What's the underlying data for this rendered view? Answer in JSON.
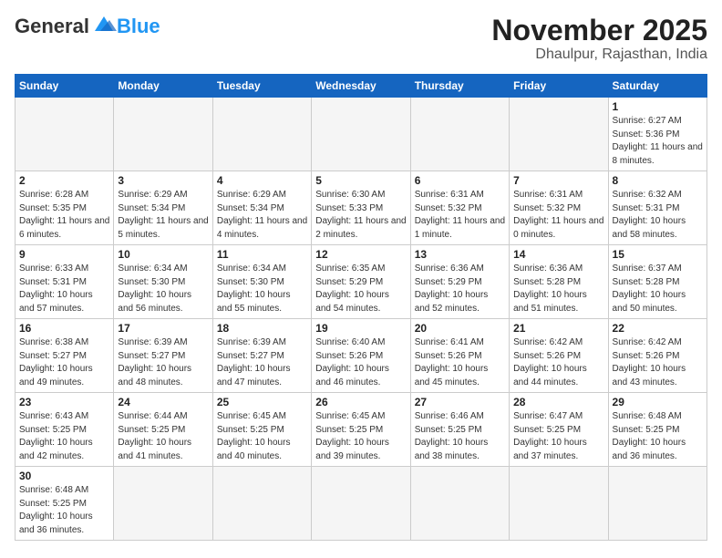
{
  "header": {
    "logo_general": "General",
    "logo_blue": "Blue",
    "month_title": "November 2025",
    "location": "Dhaulpur, Rajasthan, India"
  },
  "weekdays": [
    "Sunday",
    "Monday",
    "Tuesday",
    "Wednesday",
    "Thursday",
    "Friday",
    "Saturday"
  ],
  "weeks": [
    [
      {
        "day": "",
        "sunrise": "",
        "sunset": "",
        "daylight": "",
        "empty": true
      },
      {
        "day": "",
        "sunrise": "",
        "sunset": "",
        "daylight": "",
        "empty": true
      },
      {
        "day": "",
        "sunrise": "",
        "sunset": "",
        "daylight": "",
        "empty": true
      },
      {
        "day": "",
        "sunrise": "",
        "sunset": "",
        "daylight": "",
        "empty": true
      },
      {
        "day": "",
        "sunrise": "",
        "sunset": "",
        "daylight": "",
        "empty": true
      },
      {
        "day": "",
        "sunrise": "",
        "sunset": "",
        "daylight": "",
        "empty": true
      },
      {
        "day": "1",
        "sunrise": "Sunrise: 6:27 AM",
        "sunset": "Sunset: 5:36 PM",
        "daylight": "Daylight: 11 hours and 8 minutes.",
        "empty": false
      }
    ],
    [
      {
        "day": "2",
        "sunrise": "Sunrise: 6:28 AM",
        "sunset": "Sunset: 5:35 PM",
        "daylight": "Daylight: 11 hours and 6 minutes.",
        "empty": false
      },
      {
        "day": "3",
        "sunrise": "Sunrise: 6:29 AM",
        "sunset": "Sunset: 5:34 PM",
        "daylight": "Daylight: 11 hours and 5 minutes.",
        "empty": false
      },
      {
        "day": "4",
        "sunrise": "Sunrise: 6:29 AM",
        "sunset": "Sunset: 5:34 PM",
        "daylight": "Daylight: 11 hours and 4 minutes.",
        "empty": false
      },
      {
        "day": "5",
        "sunrise": "Sunrise: 6:30 AM",
        "sunset": "Sunset: 5:33 PM",
        "daylight": "Daylight: 11 hours and 2 minutes.",
        "empty": false
      },
      {
        "day": "6",
        "sunrise": "Sunrise: 6:31 AM",
        "sunset": "Sunset: 5:32 PM",
        "daylight": "Daylight: 11 hours and 1 minute.",
        "empty": false
      },
      {
        "day": "7",
        "sunrise": "Sunrise: 6:31 AM",
        "sunset": "Sunset: 5:32 PM",
        "daylight": "Daylight: 11 hours and 0 minutes.",
        "empty": false
      },
      {
        "day": "8",
        "sunrise": "Sunrise: 6:32 AM",
        "sunset": "Sunset: 5:31 PM",
        "daylight": "Daylight: 10 hours and 58 minutes.",
        "empty": false
      }
    ],
    [
      {
        "day": "9",
        "sunrise": "Sunrise: 6:33 AM",
        "sunset": "Sunset: 5:31 PM",
        "daylight": "Daylight: 10 hours and 57 minutes.",
        "empty": false
      },
      {
        "day": "10",
        "sunrise": "Sunrise: 6:34 AM",
        "sunset": "Sunset: 5:30 PM",
        "daylight": "Daylight: 10 hours and 56 minutes.",
        "empty": false
      },
      {
        "day": "11",
        "sunrise": "Sunrise: 6:34 AM",
        "sunset": "Sunset: 5:30 PM",
        "daylight": "Daylight: 10 hours and 55 minutes.",
        "empty": false
      },
      {
        "day": "12",
        "sunrise": "Sunrise: 6:35 AM",
        "sunset": "Sunset: 5:29 PM",
        "daylight": "Daylight: 10 hours and 54 minutes.",
        "empty": false
      },
      {
        "day": "13",
        "sunrise": "Sunrise: 6:36 AM",
        "sunset": "Sunset: 5:29 PM",
        "daylight": "Daylight: 10 hours and 52 minutes.",
        "empty": false
      },
      {
        "day": "14",
        "sunrise": "Sunrise: 6:36 AM",
        "sunset": "Sunset: 5:28 PM",
        "daylight": "Daylight: 10 hours and 51 minutes.",
        "empty": false
      },
      {
        "day": "15",
        "sunrise": "Sunrise: 6:37 AM",
        "sunset": "Sunset: 5:28 PM",
        "daylight": "Daylight: 10 hours and 50 minutes.",
        "empty": false
      }
    ],
    [
      {
        "day": "16",
        "sunrise": "Sunrise: 6:38 AM",
        "sunset": "Sunset: 5:27 PM",
        "daylight": "Daylight: 10 hours and 49 minutes.",
        "empty": false
      },
      {
        "day": "17",
        "sunrise": "Sunrise: 6:39 AM",
        "sunset": "Sunset: 5:27 PM",
        "daylight": "Daylight: 10 hours and 48 minutes.",
        "empty": false
      },
      {
        "day": "18",
        "sunrise": "Sunrise: 6:39 AM",
        "sunset": "Sunset: 5:27 PM",
        "daylight": "Daylight: 10 hours and 47 minutes.",
        "empty": false
      },
      {
        "day": "19",
        "sunrise": "Sunrise: 6:40 AM",
        "sunset": "Sunset: 5:26 PM",
        "daylight": "Daylight: 10 hours and 46 minutes.",
        "empty": false
      },
      {
        "day": "20",
        "sunrise": "Sunrise: 6:41 AM",
        "sunset": "Sunset: 5:26 PM",
        "daylight": "Daylight: 10 hours and 45 minutes.",
        "empty": false
      },
      {
        "day": "21",
        "sunrise": "Sunrise: 6:42 AM",
        "sunset": "Sunset: 5:26 PM",
        "daylight": "Daylight: 10 hours and 44 minutes.",
        "empty": false
      },
      {
        "day": "22",
        "sunrise": "Sunrise: 6:42 AM",
        "sunset": "Sunset: 5:26 PM",
        "daylight": "Daylight: 10 hours and 43 minutes.",
        "empty": false
      }
    ],
    [
      {
        "day": "23",
        "sunrise": "Sunrise: 6:43 AM",
        "sunset": "Sunset: 5:25 PM",
        "daylight": "Daylight: 10 hours and 42 minutes.",
        "empty": false
      },
      {
        "day": "24",
        "sunrise": "Sunrise: 6:44 AM",
        "sunset": "Sunset: 5:25 PM",
        "daylight": "Daylight: 10 hours and 41 minutes.",
        "empty": false
      },
      {
        "day": "25",
        "sunrise": "Sunrise: 6:45 AM",
        "sunset": "Sunset: 5:25 PM",
        "daylight": "Daylight: 10 hours and 40 minutes.",
        "empty": false
      },
      {
        "day": "26",
        "sunrise": "Sunrise: 6:45 AM",
        "sunset": "Sunset: 5:25 PM",
        "daylight": "Daylight: 10 hours and 39 minutes.",
        "empty": false
      },
      {
        "day": "27",
        "sunrise": "Sunrise: 6:46 AM",
        "sunset": "Sunset: 5:25 PM",
        "daylight": "Daylight: 10 hours and 38 minutes.",
        "empty": false
      },
      {
        "day": "28",
        "sunrise": "Sunrise: 6:47 AM",
        "sunset": "Sunset: 5:25 PM",
        "daylight": "Daylight: 10 hours and 37 minutes.",
        "empty": false
      },
      {
        "day": "29",
        "sunrise": "Sunrise: 6:48 AM",
        "sunset": "Sunset: 5:25 PM",
        "daylight": "Daylight: 10 hours and 36 minutes.",
        "empty": false
      }
    ],
    [
      {
        "day": "30",
        "sunrise": "Sunrise: 6:48 AM",
        "sunset": "Sunset: 5:25 PM",
        "daylight": "Daylight: 10 hours and 36 minutes.",
        "empty": false
      },
      {
        "day": "",
        "sunrise": "",
        "sunset": "",
        "daylight": "",
        "empty": true
      },
      {
        "day": "",
        "sunrise": "",
        "sunset": "",
        "daylight": "",
        "empty": true
      },
      {
        "day": "",
        "sunrise": "",
        "sunset": "",
        "daylight": "",
        "empty": true
      },
      {
        "day": "",
        "sunrise": "",
        "sunset": "",
        "daylight": "",
        "empty": true
      },
      {
        "day": "",
        "sunrise": "",
        "sunset": "",
        "daylight": "",
        "empty": true
      },
      {
        "day": "",
        "sunrise": "",
        "sunset": "",
        "daylight": "",
        "empty": true
      }
    ]
  ]
}
